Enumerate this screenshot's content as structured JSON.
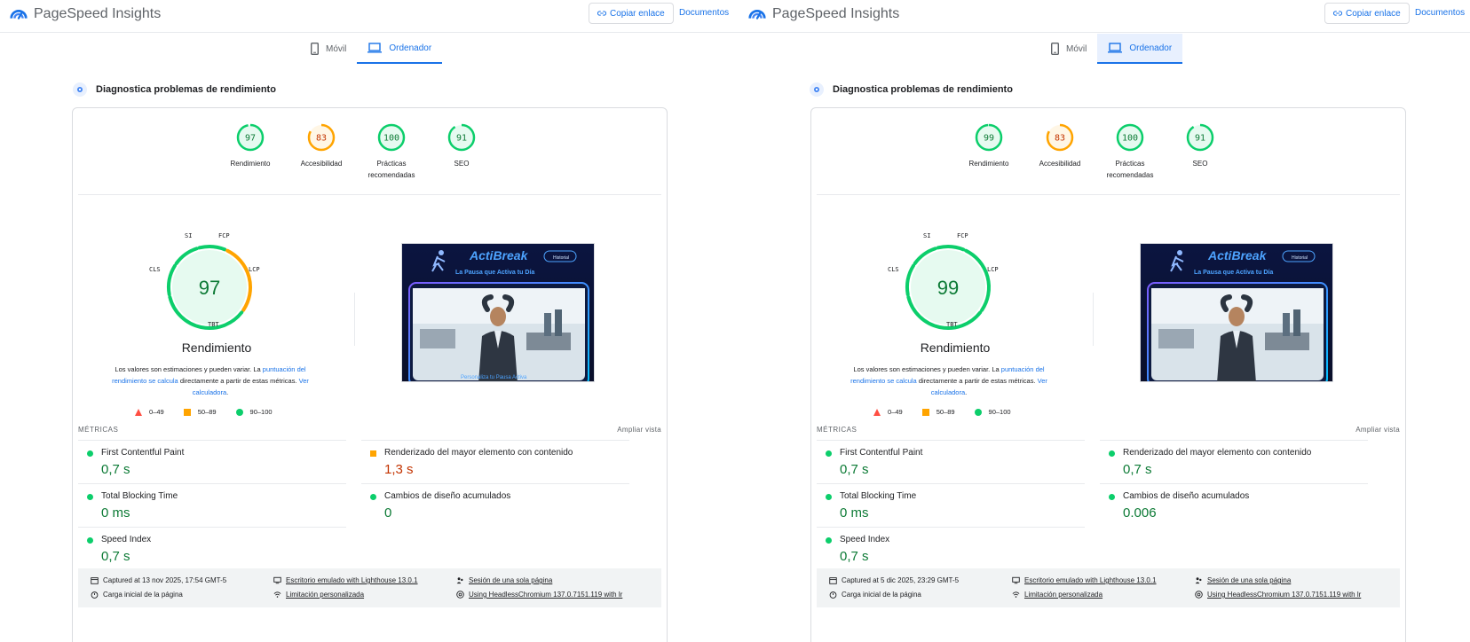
{
  "panels": [
    {
      "app_title": "PageSpeed Insights",
      "copy_link": "Copiar enlace",
      "docs": "Documentos",
      "tabs": {
        "mobile": "Móvil",
        "desktop": "Ordenador"
      },
      "section_title": "Diagnostica problemas de rendimiento",
      "categories": [
        {
          "score": "97",
          "label": "Rendimiento",
          "color": "#0cce6b",
          "status": "good"
        },
        {
          "score": "83",
          "label": "Accesibilidad",
          "color": "#ffa400",
          "status": "average"
        },
        {
          "score": "100",
          "label": "Prácticas recomendadas",
          "color": "#0cce6b",
          "status": "good"
        },
        {
          "score": "91",
          "label": "SEO",
          "color": "#0cce6b",
          "status": "good"
        }
      ],
      "performance": {
        "score": "97",
        "title": "Rendimiento",
        "segment_labels": {
          "si": "SI",
          "fcp": "FCP",
          "lcp": "LCP",
          "tbt": "TBT",
          "cls": "CLS"
        },
        "lcp_segment_status": "average",
        "note_start": "Los valores son estimaciones y pueden variar. La ",
        "note_link1": "puntuación del rendimiento se calcula",
        "note_mid": " directamente a partir de estas métricas. ",
        "note_link2": "Ver calculadora",
        "note_end": "."
      },
      "legend": {
        "poor": "0–49",
        "average": "50–89",
        "good": "90–100"
      },
      "screenshot": {
        "brand": "ActiBreak",
        "tagline": "La Pausa que Activa tu Día",
        "badge": "Historial",
        "caption": "Personaliza tu Pausa Activa"
      },
      "metrics_header": "MÉTRICAS",
      "expand_view": "Ampliar vista",
      "metrics": [
        {
          "name": "First Contentful Paint",
          "value": "0,7 s",
          "status": "good"
        },
        {
          "name": "Renderizado del mayor elemento con contenido",
          "value": "1,3 s",
          "status": "average"
        },
        {
          "name": "Total Blocking Time",
          "value": "0 ms",
          "status": "good"
        },
        {
          "name": "Cambios de diseño acumulados",
          "value": "0",
          "status": "good"
        },
        {
          "name": "Speed Index",
          "value": "0,7 s",
          "status": "good"
        }
      ],
      "footer": {
        "captured": "Captured at 13 nov 2025, 17:54 GMT-5",
        "emulated": "Escritorio emulado with Lighthouse 13.0.1",
        "session": "Sesión de una sola página",
        "load": "Carga inicial de la página",
        "throttling": "Limitación personalizada",
        "browser": "Using HeadlessChromium 137.0.7151.119 with lr"
      }
    },
    {
      "app_title": "PageSpeed Insights",
      "copy_link": "Copiar enlace",
      "docs": "Documentos",
      "tabs": {
        "mobile": "Móvil",
        "desktop": "Ordenador"
      },
      "section_title": "Diagnostica problemas de rendimiento",
      "categories": [
        {
          "score": "99",
          "label": "Rendimiento",
          "color": "#0cce6b",
          "status": "good"
        },
        {
          "score": "83",
          "label": "Accesibilidad",
          "color": "#ffa400",
          "status": "average"
        },
        {
          "score": "100",
          "label": "Prácticas recomendadas",
          "color": "#0cce6b",
          "status": "good"
        },
        {
          "score": "91",
          "label": "SEO",
          "color": "#0cce6b",
          "status": "good"
        }
      ],
      "performance": {
        "score": "99",
        "title": "Rendimiento",
        "segment_labels": {
          "si": "SI",
          "fcp": "FCP",
          "lcp": "LCP",
          "tbt": "TBT",
          "cls": "CLS"
        },
        "lcp_segment_status": "good",
        "note_start": "Los valores son estimaciones y pueden variar. La ",
        "note_link1": "puntuación del rendimiento se calcula",
        "note_mid": " directamente a partir de estas métricas. ",
        "note_link2": "Ver calculadora",
        "note_end": "."
      },
      "legend": {
        "poor": "0–49",
        "average": "50–89",
        "good": "90–100"
      },
      "screenshot": {
        "brand": "ActiBreak",
        "tagline": "La Pausa que Activa tu Día",
        "badge": "Historial",
        "caption": ""
      },
      "metrics_header": "MÉTRICAS",
      "expand_view": "Ampliar vista",
      "metrics": [
        {
          "name": "First Contentful Paint",
          "value": "0,7 s",
          "status": "good"
        },
        {
          "name": "Renderizado del mayor elemento con contenido",
          "value": "0,7 s",
          "status": "good"
        },
        {
          "name": "Total Blocking Time",
          "value": "0 ms",
          "status": "good"
        },
        {
          "name": "Cambios de diseño acumulados",
          "value": "0.006",
          "status": "good"
        },
        {
          "name": "Speed Index",
          "value": "0,7 s",
          "status": "good"
        }
      ],
      "footer": {
        "captured": "Captured at 5 dic 2025, 23:29 GMT-5",
        "emulated": "Escritorio emulado with Lighthouse 13.0.1",
        "session": "Sesión de una sola página",
        "load": "Carga inicial de la página",
        "throttling": "Limitación personalizada",
        "browser": "Using HeadlessChromium 137.0.7151.119 with lr"
      }
    }
  ],
  "colors": {
    "good": "#0cce6b",
    "average": "#ffa400",
    "poor": "#ff4e42",
    "link": "#1a73e8",
    "good_text": "#0c7a35",
    "avg_text": "#c33300"
  }
}
